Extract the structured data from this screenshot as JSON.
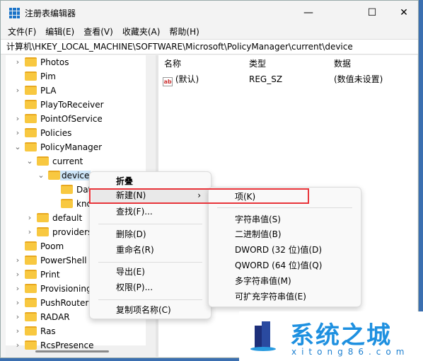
{
  "window": {
    "title": "注册表编辑器",
    "controls": [
      "minimize",
      "maximize",
      "close"
    ]
  },
  "menu": [
    "文件(F)",
    "编辑(E)",
    "查看(V)",
    "收藏夹(A)",
    "帮助(H)"
  ],
  "address": "计算机\\HKEY_LOCAL_MACHINE\\SOFTWARE\\Microsoft\\PolicyManager\\current\\device",
  "tree": [
    {
      "label": "Photos",
      "level": 1,
      "expander": "collapsed"
    },
    {
      "label": "Pim",
      "level": 1,
      "expander": "none"
    },
    {
      "label": "PLA",
      "level": 1,
      "expander": "collapsed"
    },
    {
      "label": "PlayToReceiver",
      "level": 1,
      "expander": "none"
    },
    {
      "label": "PointOfService",
      "level": 1,
      "expander": "collapsed"
    },
    {
      "label": "Policies",
      "level": 1,
      "expander": "collapsed"
    },
    {
      "label": "PolicyManager",
      "level": 1,
      "expander": "expanded"
    },
    {
      "label": "current",
      "level": 2,
      "expander": "expanded"
    },
    {
      "label": "device",
      "level": 3,
      "expander": "expanded",
      "selected": true
    },
    {
      "label": "DataProtection",
      "level": 4,
      "expander": "none"
    },
    {
      "label": "knobs",
      "level": 4,
      "expander": "none"
    },
    {
      "label": "default",
      "level": 2,
      "expander": "collapsed"
    },
    {
      "label": "providers",
      "level": 2,
      "expander": "collapsed"
    },
    {
      "label": "Poom",
      "level": 1,
      "expander": "none"
    },
    {
      "label": "PowerShell",
      "level": 1,
      "expander": "collapsed"
    },
    {
      "label": "Print",
      "level": 1,
      "expander": "collapsed"
    },
    {
      "label": "Provisioning",
      "level": 1,
      "expander": "collapsed"
    },
    {
      "label": "PushRouter",
      "level": 1,
      "expander": "collapsed"
    },
    {
      "label": "RADAR",
      "level": 1,
      "expander": "collapsed"
    },
    {
      "label": "Ras",
      "level": 1,
      "expander": "collapsed"
    },
    {
      "label": "RcsPresence",
      "level": 1,
      "expander": "collapsed"
    }
  ],
  "list": {
    "columns": [
      "名称",
      "类型",
      "数据"
    ],
    "rows": [
      {
        "name": "(默认)",
        "type": "REG_SZ",
        "data": "(数值未设置)",
        "icon": "string-value-icon"
      }
    ]
  },
  "context_menu": {
    "items": [
      "折叠",
      "新建(N)",
      "查找(F)...",
      "删除(D)",
      "重命名(R)",
      "导出(E)",
      "权限(P)...",
      "复制项名称(C)"
    ],
    "highlighted": "新建(N)"
  },
  "submenu": {
    "items": [
      "项(K)",
      "字符串值(S)",
      "二进制值(B)",
      "DWORD (32 位)值(D)",
      "QWORD (64 位)值(Q)",
      "多字符串值(M)",
      "可扩充字符串值(E)"
    ]
  },
  "watermark": {
    "text": "系统之城",
    "url": "xitong86.com"
  },
  "colors": {
    "highlight_box": "#e8343a",
    "selection": "#cce4f7",
    "folder": "#f8c840"
  }
}
